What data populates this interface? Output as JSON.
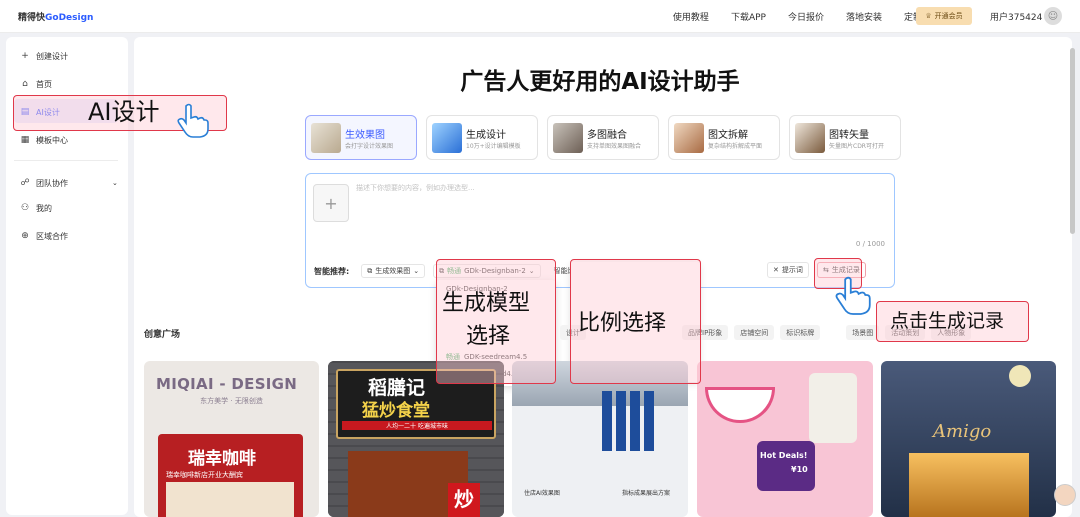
{
  "topbar": {
    "logo_main": "精得快",
    "logo_brand": "GoDesign",
    "nav": [
      "使用教程",
      "下载APP",
      "今日报价",
      "落地安装",
      "定制设计"
    ],
    "vip_label": "开通会员",
    "user_label": "用户375424"
  },
  "sidebar": {
    "create": "创建设计",
    "home": "首页",
    "ai": "AI设计",
    "templates": "模板中心",
    "team": "团队协作",
    "mine": "我的",
    "regional": "区域合作"
  },
  "main": {
    "title": "广告人更好用的AI设计助手",
    "cards": [
      {
        "title": "生效果图",
        "sub": "会打字设计效果图"
      },
      {
        "title": "生成设计",
        "sub": "10万+设计编辑模板"
      },
      {
        "title": "多图融合",
        "sub": "支持单图效果图融合"
      },
      {
        "title": "图文拆解",
        "sub": "复杂结构拆解成平面"
      },
      {
        "title": "图转矢量",
        "sub": "矢量图片CDR可打开"
      }
    ],
    "prompt_placeholder": "描述下你想要的内容，例如办理选型...",
    "counter": "0 / 1000",
    "smart_label": "智能推荐:",
    "chip_effect": "生成效果图",
    "chip_model_tag": "畅通",
    "chip_model": "GDk-Designban-2",
    "chip_ratio": "智能比例",
    "btn_prompt": "提示词",
    "btn_history": "生成记录"
  },
  "models": [
    {
      "tag": "畅通",
      "name": "GDk-Designban-2"
    },
    {
      "tag": "畅通",
      "name": "GDK-seedream4.5"
    },
    {
      "tag": "畅通",
      "name": "GDK-JMseed4.0"
    }
  ],
  "gallery": {
    "section_title": "创意广场",
    "tags": [
      "设计",
      "品牌IP形象",
      "店铺空间",
      "标识标牌",
      "场景图",
      "活动策划",
      "人物形象"
    ],
    "miqiai_title": "MIQIAI - DESIGN",
    "miqiai_sub": "东方美学 · 无限创造",
    "cafe": "瑞幸咖啡",
    "cafe_sub": "瑞幸咖啡新店开业大酬宾",
    "restaurant": "稻膳记",
    "restaurant2": "猛炒食堂",
    "restaurant_sub": "人均一二十 吃遍城市味",
    "chao": "炒",
    "hotdeals": "Hot Deals!",
    "price": "¥10",
    "amigo": "Amigo",
    "sign_caption_1": "住店AI效果图",
    "sign_caption_2": "指标成果展出方案"
  },
  "annotations": {
    "ai_design": "AI设计",
    "model_select_1": "生成模型",
    "model_select_2": "选择",
    "ratio_select": "比例选择",
    "history_click": "点击生成记录"
  },
  "colors": {
    "accent": "#3b5bff",
    "annotation_red": "#e0384a",
    "status_green": "#4ab36b",
    "vip_gold": "#f8ddb0"
  }
}
